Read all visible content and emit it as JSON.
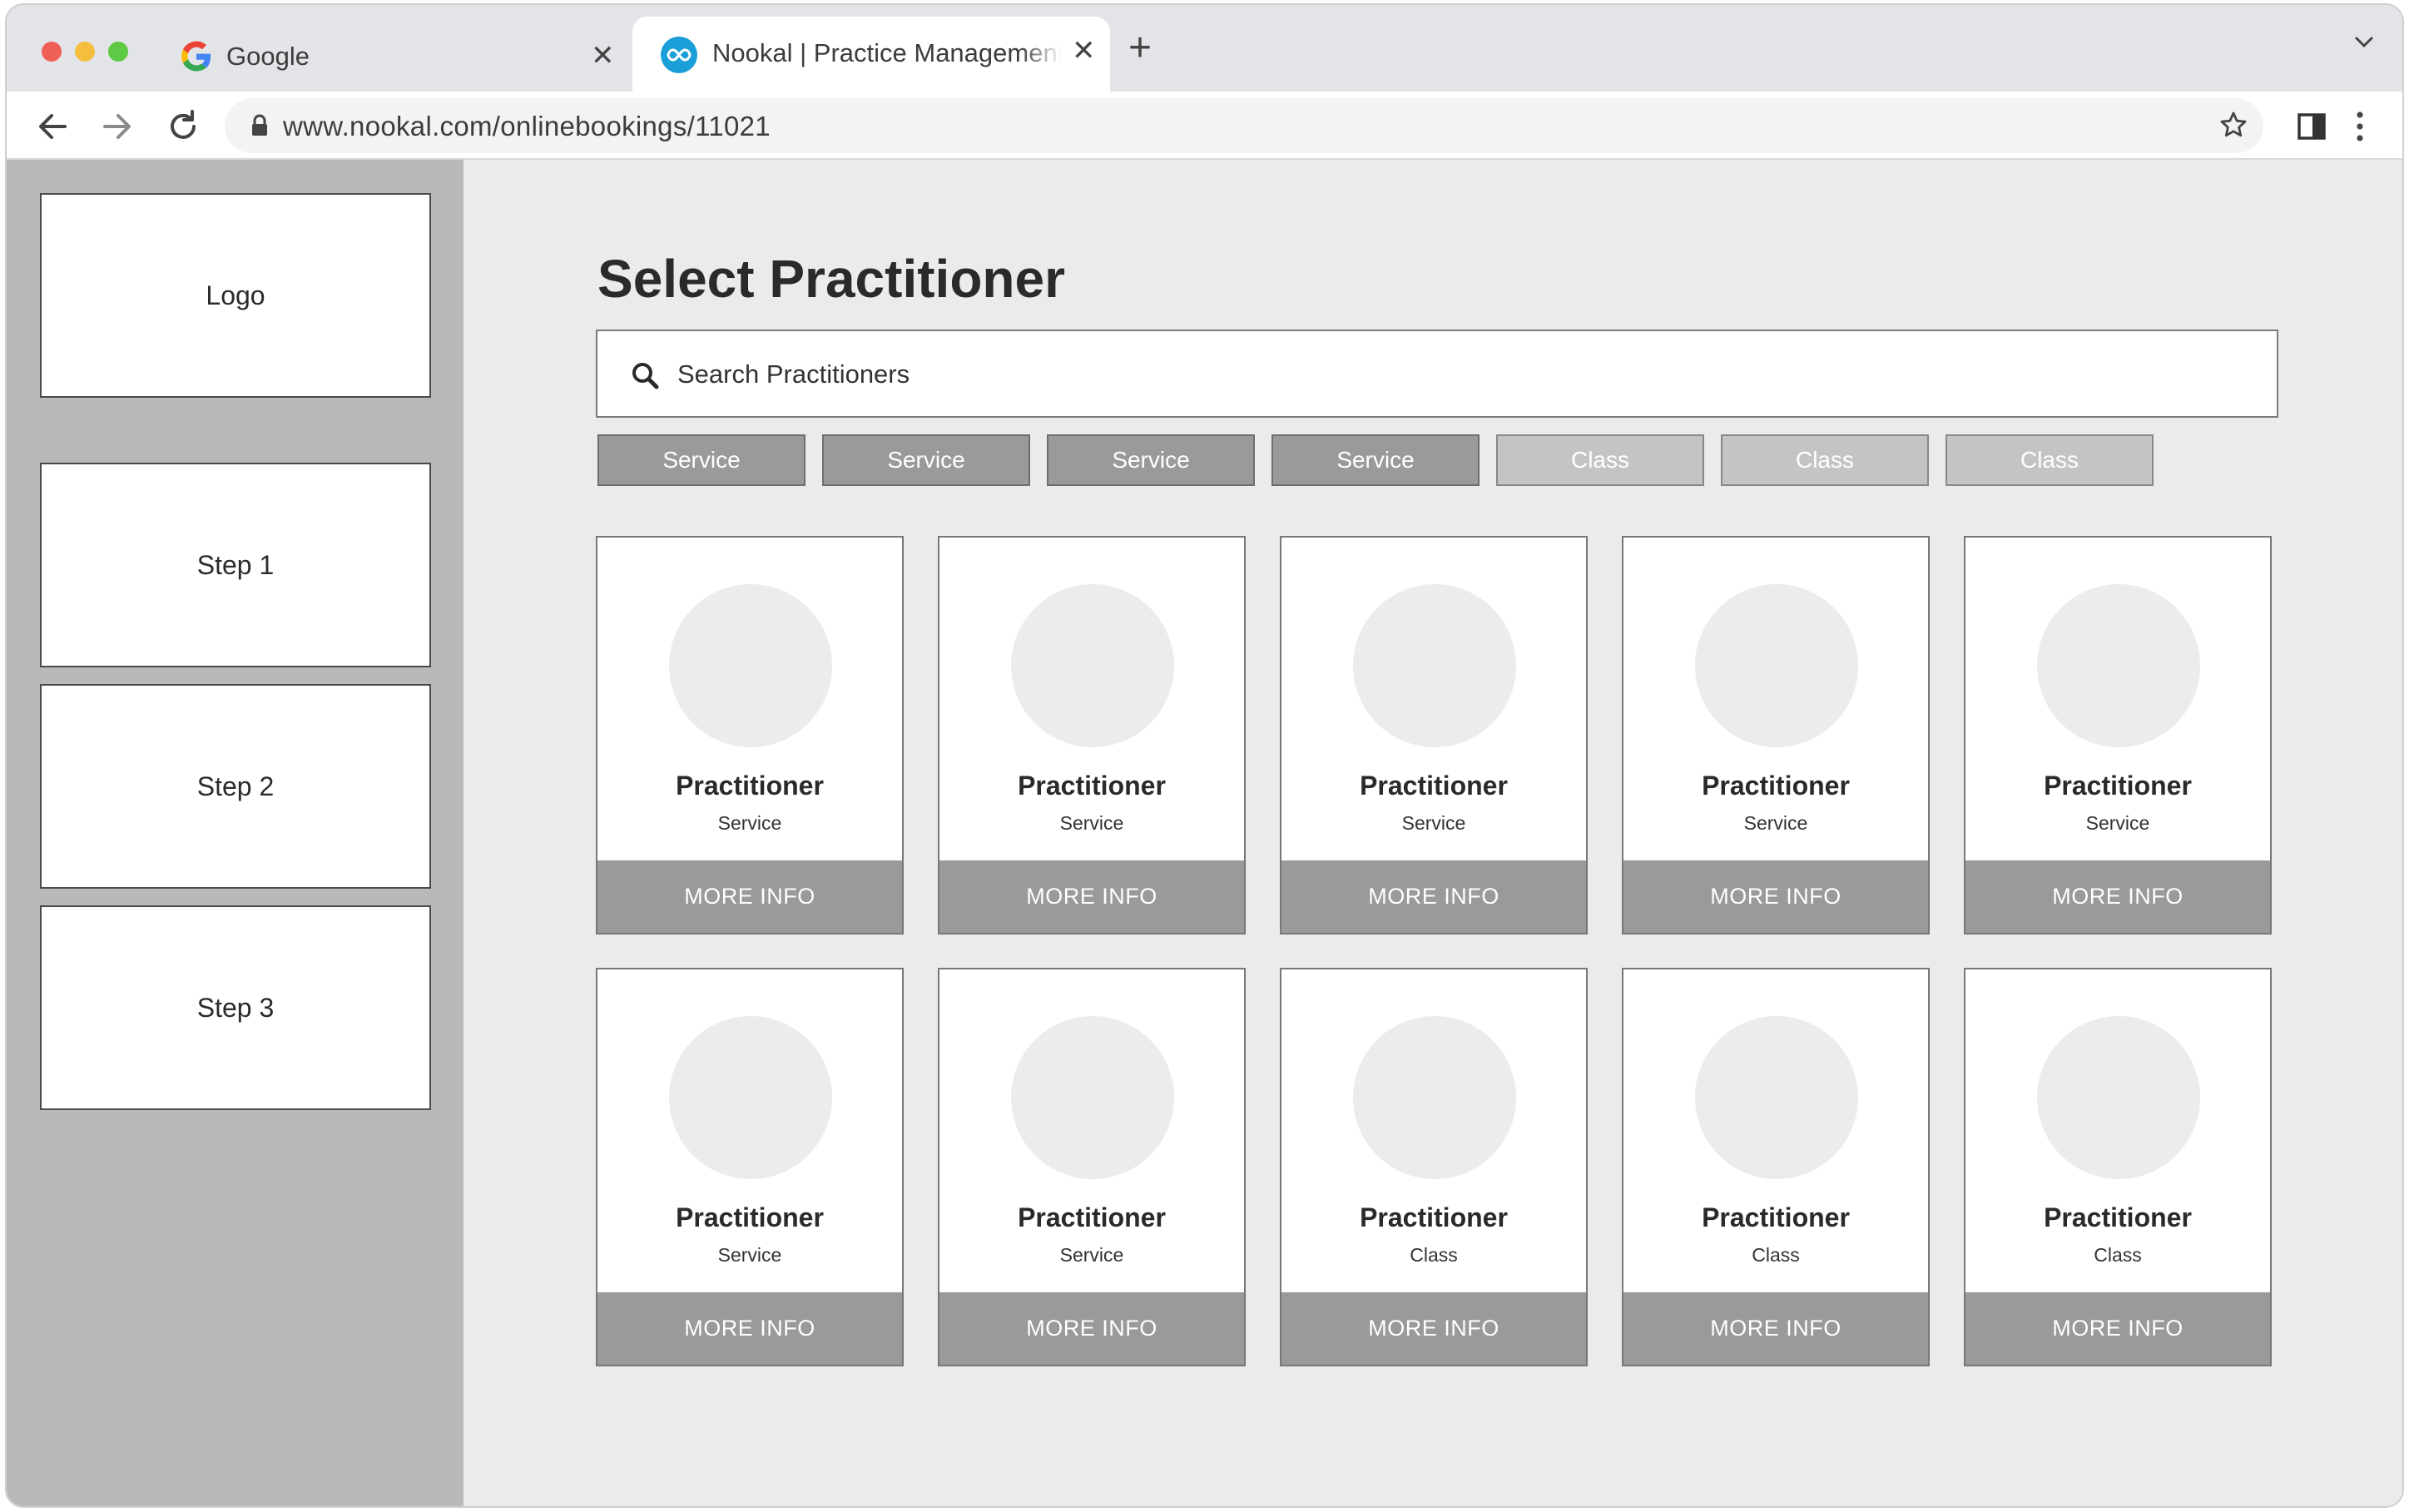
{
  "browser": {
    "tabs": [
      {
        "title": "Google",
        "icon": "google-icon"
      },
      {
        "title": "Nookal | Practice Management",
        "icon": "nookal-icon",
        "active": true
      }
    ],
    "url": "www.nookal.com/onlinebookings/11021"
  },
  "sidebar": {
    "logo": "Logo",
    "steps": [
      "Step 1",
      "Step 2",
      "Step 3"
    ]
  },
  "main": {
    "title": "Select Practitioner",
    "search_placeholder": "Search Practitioners",
    "filters": [
      {
        "label": "Service",
        "kind": "service"
      },
      {
        "label": "Service",
        "kind": "service"
      },
      {
        "label": "Service",
        "kind": "service"
      },
      {
        "label": "Service",
        "kind": "service"
      },
      {
        "label": "Class",
        "kind": "class"
      },
      {
        "label": "Class",
        "kind": "class"
      },
      {
        "label": "Class",
        "kind": "class"
      }
    ],
    "cards": [
      {
        "name": "Practitioner",
        "type": "Service",
        "button": "MORE INFO"
      },
      {
        "name": "Practitioner",
        "type": "Service",
        "button": "MORE INFO"
      },
      {
        "name": "Practitioner",
        "type": "Service",
        "button": "MORE INFO"
      },
      {
        "name": "Practitioner",
        "type": "Service",
        "button": "MORE INFO"
      },
      {
        "name": "Practitioner",
        "type": "Service",
        "button": "MORE INFO"
      },
      {
        "name": "Practitioner",
        "type": "Service",
        "button": "MORE INFO"
      },
      {
        "name": "Practitioner",
        "type": "Service",
        "button": "MORE INFO"
      },
      {
        "name": "Practitioner",
        "type": "Class",
        "button": "MORE INFO"
      },
      {
        "name": "Practitioner",
        "type": "Class",
        "button": "MORE INFO"
      },
      {
        "name": "Practitioner",
        "type": "Class",
        "button": "MORE INFO"
      }
    ]
  },
  "colors": {
    "sidebar_bg": "#b9b9b9",
    "content_bg": "#ebebeb",
    "service_chip": "#9a9a9a",
    "class_chip": "#c4c4c4",
    "card_button": "#9a9a9a",
    "nookal_brand": "#1a9fd8"
  }
}
